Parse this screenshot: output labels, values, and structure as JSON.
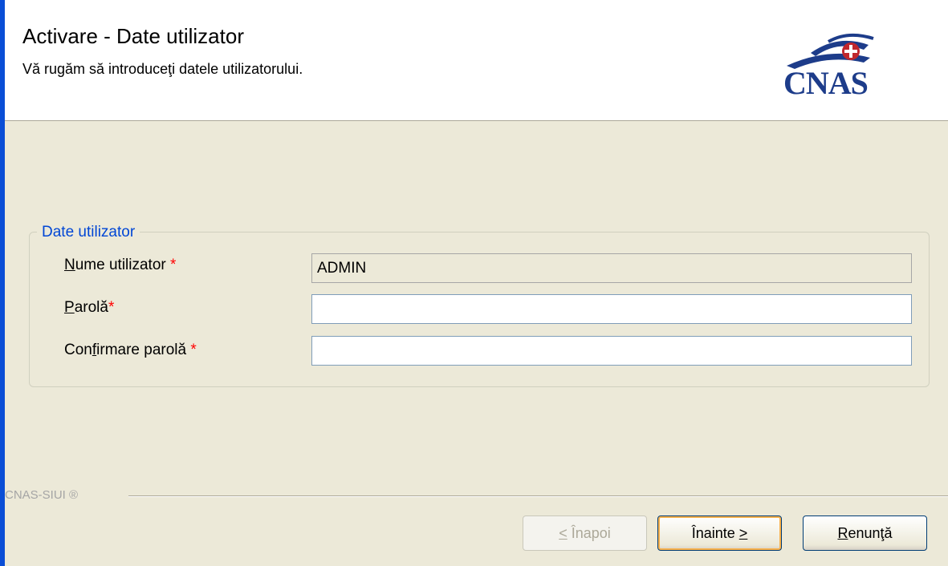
{
  "header": {
    "title": "Activare - Date utilizator",
    "subtitle": "Vă rugăm să introduceţi datele utilizatorului.",
    "logo_text": "CNAS"
  },
  "group": {
    "legend": "Date utilizator",
    "fields": [
      {
        "label_accel": "N",
        "label_rest": "ume utilizator",
        "required_mark": "*",
        "value": "ADMIN",
        "readonly": true
      },
      {
        "label_accel": "P",
        "label_rest": "arolă",
        "required_mark": "*",
        "value": "",
        "readonly": false
      },
      {
        "label_pre": "Con",
        "label_accel": "f",
        "label_rest": "irmare parolă",
        "required_mark": "*",
        "value": "",
        "readonly": false
      }
    ]
  },
  "footer": {
    "brand": "CNAS-SIUI ®"
  },
  "buttons": {
    "back_accel": "<",
    "back_rest": " Înapoi",
    "next_label": "Înainte ",
    "next_accel": ">",
    "cancel_accel": "R",
    "cancel_rest": "enunţă"
  },
  "colors": {
    "frame_blue": "#0a4ed6",
    "dialog_bg": "#ece9d8",
    "legend_blue": "#0046d5",
    "required_red": "#ff0000",
    "logo_navy": "#1d3c8a",
    "logo_red": "#c0272d"
  }
}
